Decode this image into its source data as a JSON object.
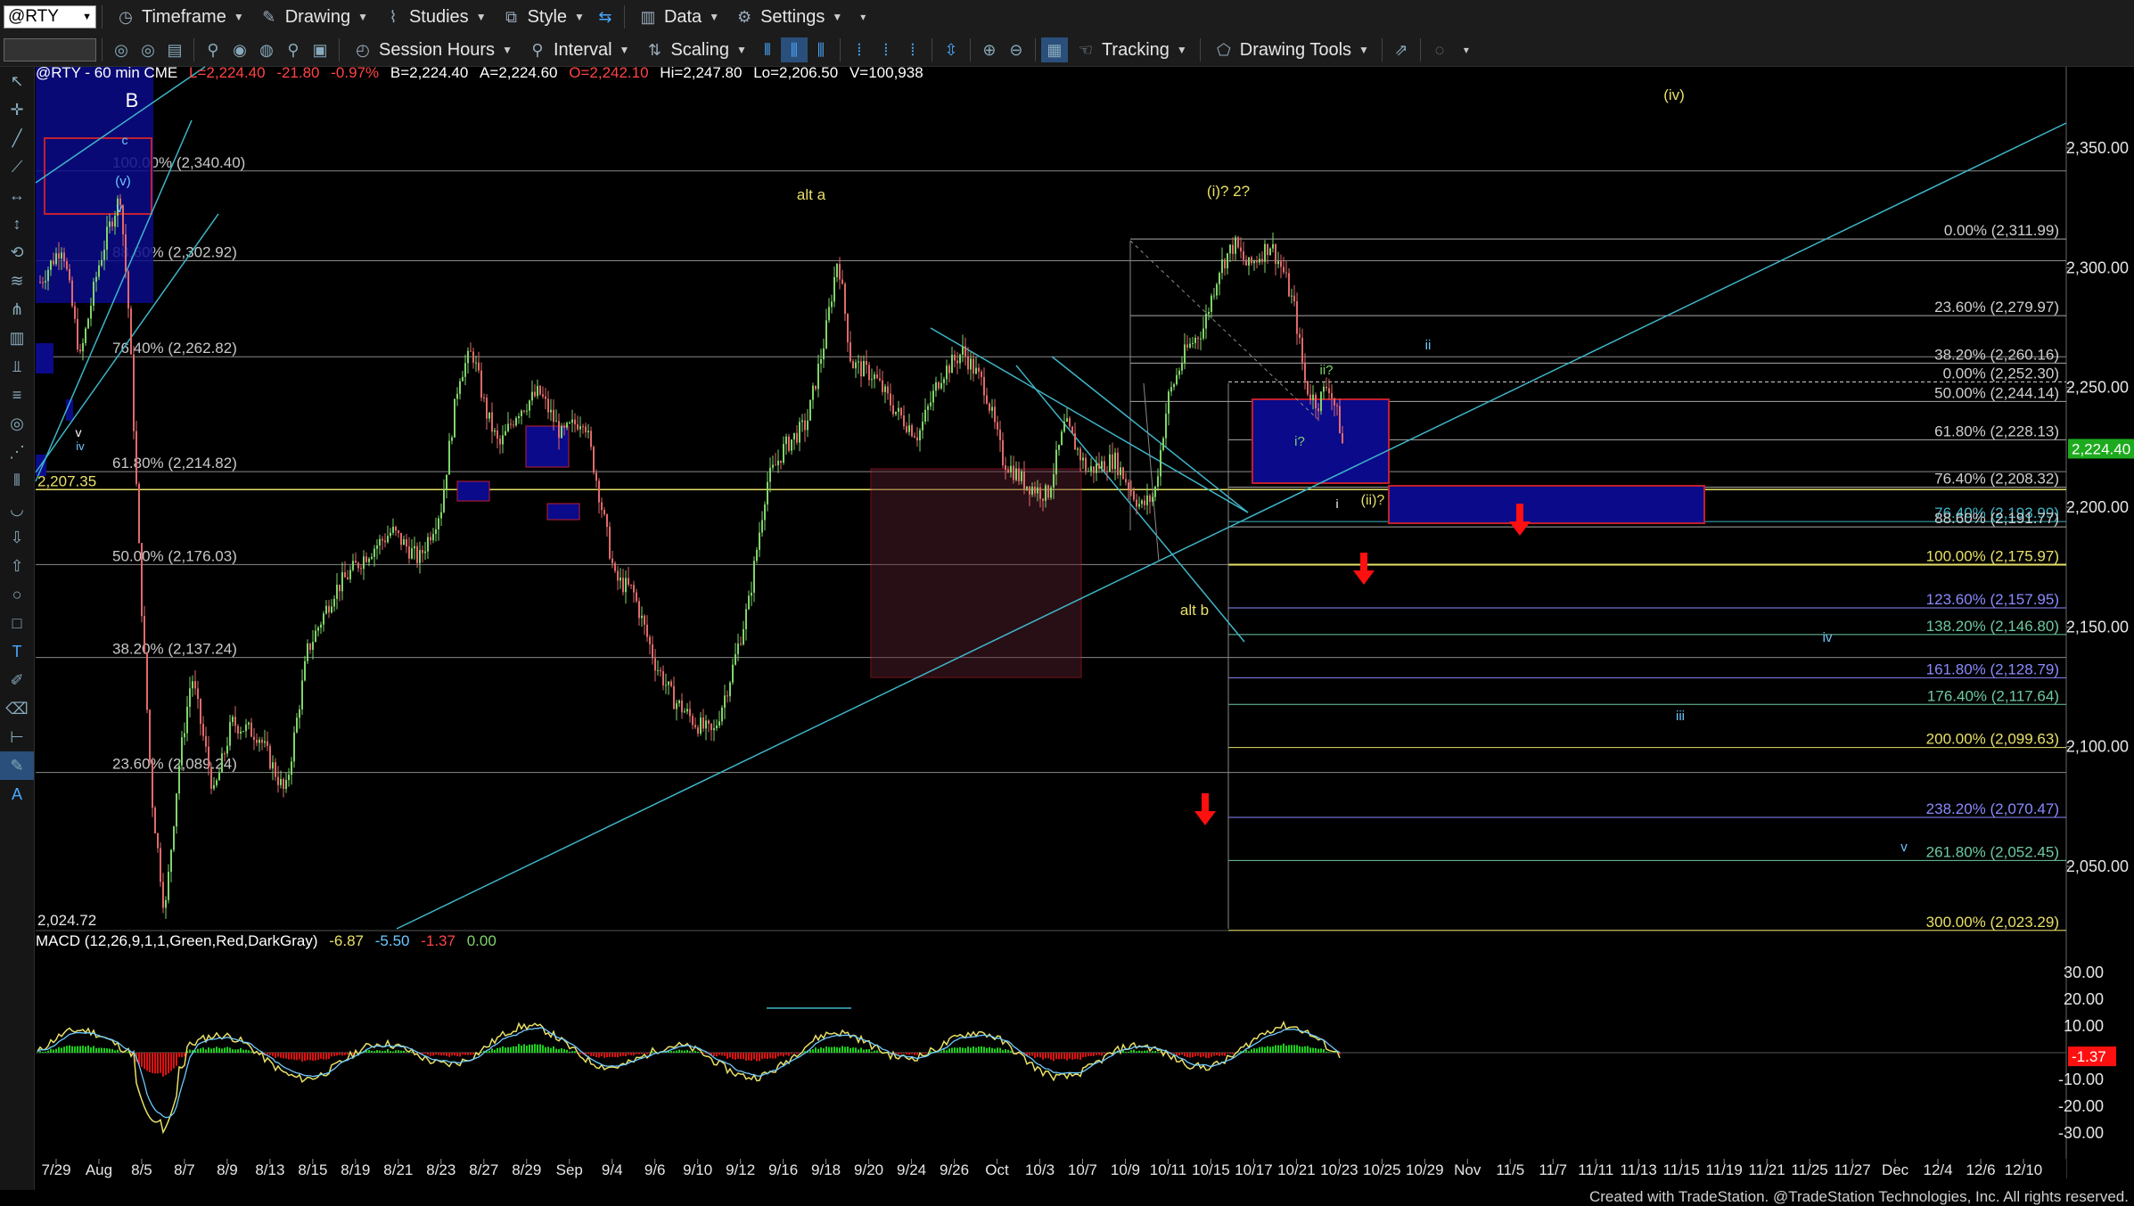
{
  "toolbar": {
    "symbol": "@RTY",
    "items": [
      "Timeframe",
      "Drawing",
      "Studies",
      "Style",
      "Data",
      "Settings"
    ],
    "items2": [
      "Session Hours",
      "Interval",
      "Scaling",
      "Tracking",
      "Drawing Tools"
    ]
  },
  "header": {
    "symbol_line": "@RTY - 60 min  CME",
    "last": "L=2,224.40",
    "chg": "-21.80",
    "pct": "-0.97%",
    "bid": "B=2,224.40",
    "ask": "A=2,224.60",
    "open": "O=2,242.10",
    "hi": "Hi=2,247.80",
    "lo": "Lo=2,206.50",
    "vol": "V=100,938"
  },
  "macd_header": {
    "name": "MACD (12,26,9,1,1,Green,Red,DarkGray)",
    "v1": "-6.87",
    "v2": "-5.50",
    "v3": "-1.37",
    "v4": "0.00"
  },
  "colors": {
    "up": "#7fd46a",
    "down": "#e06a6a",
    "cyan": "#3fb5c8",
    "yellow": "#e8e066",
    "grid": "#3a3a3a",
    "blue_box": "#0a0a8a",
    "red_box": "#c02030"
  },
  "chart_data": {
    "type": "candlestick",
    "y_ticks": [
      "2,350.00",
      "2,300.00",
      "2,250.00",
      "2,200.00",
      "2,150.00",
      "2,100.00",
      "2,050.00"
    ],
    "ylim": [
      2020,
      2380
    ],
    "last_price_tag": "2,224.40",
    "x_labels": [
      "7/29",
      "Aug",
      "8/5",
      "8/7",
      "8/9",
      "8/13",
      "8/15",
      "8/19",
      "8/21",
      "8/23",
      "8/27",
      "8/29",
      "Sep",
      "9/4",
      "9/6",
      "9/10",
      "9/12",
      "9/16",
      "9/18",
      "9/20",
      "9/24",
      "9/26",
      "Oct",
      "10/3",
      "10/7",
      "10/9",
      "10/11",
      "10/15",
      "10/17",
      "10/21",
      "10/23",
      "10/25",
      "10/29",
      "Nov",
      "11/5",
      "11/7",
      "11/11",
      "11/13",
      "11/15",
      "11/19",
      "11/21",
      "11/25",
      "11/27",
      "Dec",
      "12/4",
      "12/6",
      "12/10"
    ],
    "macd_ticks": [
      "30.00",
      "20.00",
      "10.00",
      "-10.00",
      "-20.00",
      "-30.00"
    ],
    "macd_tag": "-1.37",
    "left_fib": [
      {
        "label": "100.00% (2,340.40)",
        "price": 2340.4
      },
      {
        "label": "88.60% (2,302.92)",
        "price": 2302.92
      },
      {
        "label": "76.40% (2,262.82)",
        "price": 2262.82
      },
      {
        "label": "61.80% (2,214.82)",
        "price": 2214.82
      },
      {
        "label": "50.00% (2,176.03)",
        "price": 2176.03
      },
      {
        "label": "38.20% (2,137.24)",
        "price": 2137.24
      },
      {
        "label": "23.60% (2,089.24)",
        "price": 2089.24
      }
    ],
    "right_fib": [
      {
        "label": "0.00% (2,311.99)",
        "price": 2311.99
      },
      {
        "label": "23.60% (2,279.97)",
        "price": 2279.97
      },
      {
        "label": "38.20% (2,260.16)",
        "price": 2260.16
      },
      {
        "label": "0.00% (2,252.30)",
        "price": 2252.3
      },
      {
        "label": "50.00% (2,244.14)",
        "price": 2244.14
      },
      {
        "label": "61.80% (2,228.13)",
        "price": 2228.13
      },
      {
        "label": "76.40% (2,208.32)",
        "price": 2208.32
      },
      {
        "label": "76.40% (2,193.99)",
        "price": 2193.99
      },
      {
        "label": "88.60% (2,191.77)",
        "price": 2191.77
      },
      {
        "label": "100.00% (2,175.97)",
        "price": 2175.97
      },
      {
        "label": "123.60% (2,157.95)",
        "price": 2157.95
      },
      {
        "label": "138.20% (2,146.80)",
        "price": 2146.8
      },
      {
        "label": "161.80% (2,128.79)",
        "price": 2128.79
      },
      {
        "label": "176.40% (2,117.64)",
        "price": 2117.64
      },
      {
        "label": "200.00% (2,099.63)",
        "price": 2099.63
      },
      {
        "label": "238.20% (2,070.47)",
        "price": 2070.47
      },
      {
        "label": "261.80% (2,052.45)",
        "price": 2052.45
      },
      {
        "label": "300.00% (2,023.29)",
        "price": 2023.29
      }
    ],
    "side_labels": {
      "p2207": "2,207.35",
      "p2024": "2,024.72"
    },
    "wave_labels": {
      "B": "B",
      "c": "c",
      "v_top": "(v)",
      "v_small": "v",
      "iv_small": "iv",
      "alt_a": "alt a",
      "i2": "(i)? 2?",
      "ii_q": "ii?",
      "i_q": "i?",
      "i_small": "i",
      "ii_wave": "(ii)?",
      "alt_b": "alt b",
      "ii_right": "ii",
      "iv_right": "iv",
      "iii_right": "iii",
      "v_right": "v",
      "iv_top": "(iv)"
    }
  },
  "footer": "Created with TradeStation. @TradeStation Technologies, Inc. All rights reserved."
}
